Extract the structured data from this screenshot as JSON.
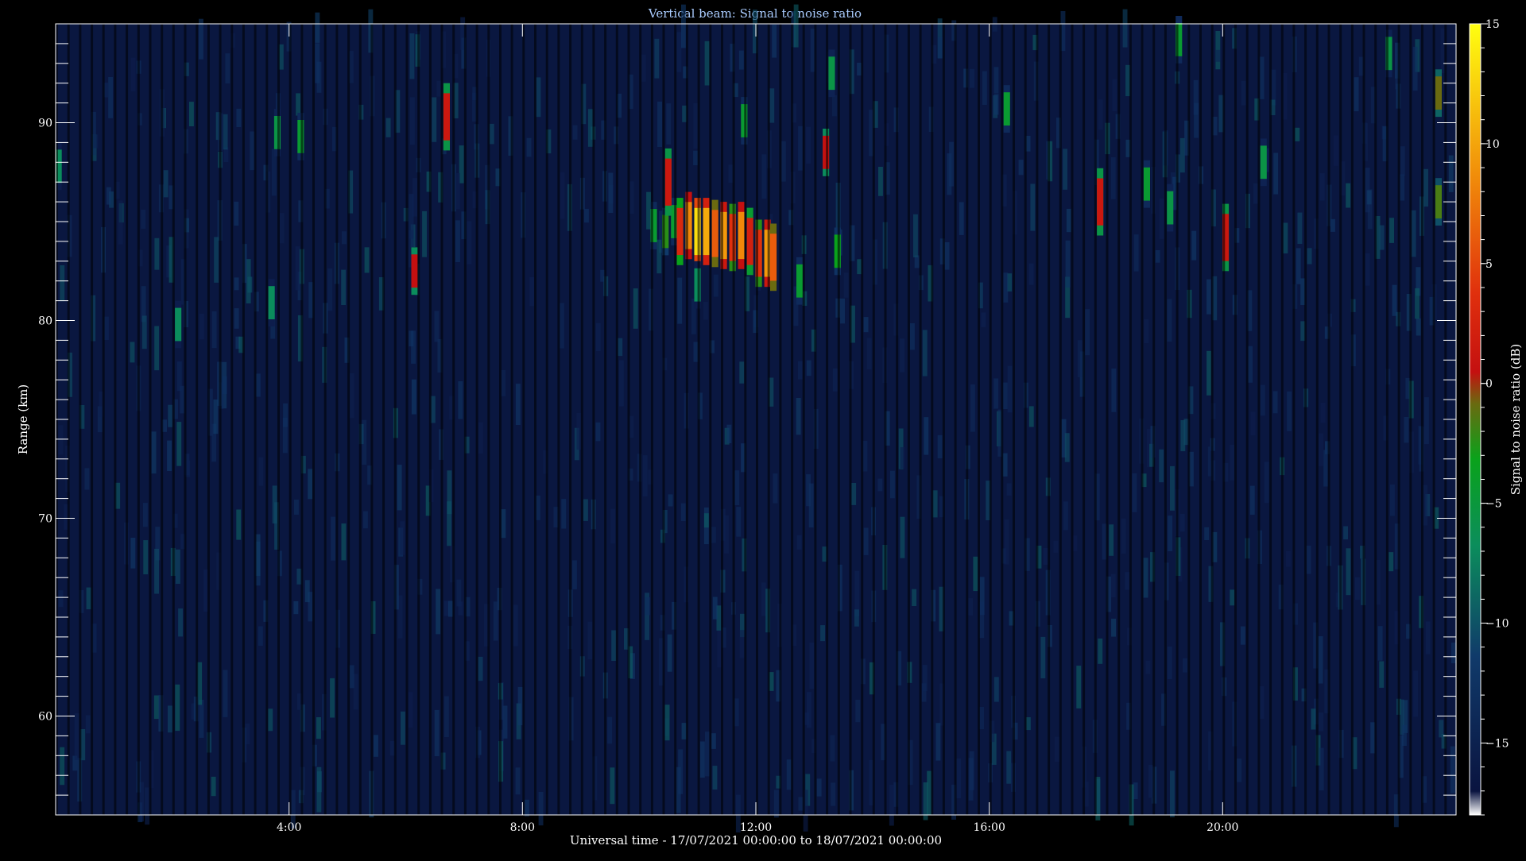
{
  "chart_data": {
    "type": "heatmap",
    "title": "Vertical beam: Signal to noise ratio",
    "xlabel": "Universal time - 17/07/2021 00:00:00 to 18/07/2021 00:00:00",
    "ylabel": "Range (km)",
    "colorbar_label": "Signal to noise ratio (dB)",
    "x_unit": "hours UT",
    "xlim": [
      0,
      24
    ],
    "ylim": [
      55,
      95
    ],
    "x_major_ticks": [
      4,
      8,
      12,
      16,
      20
    ],
    "x_tick_labels": [
      "4:00",
      "8:00",
      "12:00",
      "16:00",
      "20:00"
    ],
    "y_major_ticks": [
      60,
      70,
      80,
      90
    ],
    "y_tick_labels": [
      "60",
      "70",
      "80",
      "90"
    ],
    "y_minor_step": 1,
    "colorbar": {
      "min": -18,
      "max": 15,
      "ticks": [
        15,
        10,
        5,
        0,
        -5,
        -10,
        -15
      ],
      "tick_labels": [
        "15",
        "10",
        "5",
        "0",
        "−5",
        "−10",
        "−15"
      ]
    },
    "background_snr_db": -16,
    "strong_echoes": [
      {
        "time": 10.45,
        "range": 84.5,
        "snr": -4
      },
      {
        "time": 10.6,
        "range": 85.0,
        "snr": -6
      },
      {
        "time": 10.7,
        "range": 84.5,
        "snr": 3
      },
      {
        "time": 10.85,
        "range": 84.8,
        "snr": 8
      },
      {
        "time": 11.0,
        "range": 84.5,
        "snr": 13
      },
      {
        "time": 11.15,
        "range": 84.5,
        "snr": 10
      },
      {
        "time": 11.3,
        "range": 84.4,
        "snr": 6
      },
      {
        "time": 11.45,
        "range": 84.3,
        "snr": 9
      },
      {
        "time": 11.6,
        "range": 84.2,
        "snr": 4
      },
      {
        "time": 11.75,
        "range": 84.3,
        "snr": 8
      },
      {
        "time": 11.9,
        "range": 84.0,
        "snr": 2
      },
      {
        "time": 12.05,
        "range": 83.4,
        "snr": 4
      },
      {
        "time": 12.2,
        "range": 83.4,
        "snr": 9
      },
      {
        "time": 12.3,
        "range": 83.2,
        "snr": 6
      },
      {
        "time": 12.75,
        "range": 82.0,
        "snr": -6
      },
      {
        "time": 6.15,
        "range": 82.5,
        "snr": 0
      },
      {
        "time": 6.7,
        "range": 90.3,
        "snr": 1
      },
      {
        "time": 10.25,
        "range": 84.8,
        "snr": -6
      },
      {
        "time": 11.0,
        "range": 81.8,
        "snr": -8
      },
      {
        "time": 13.2,
        "range": 88.5,
        "snr": 0
      },
      {
        "time": 13.4,
        "range": 83.5,
        "snr": -5
      },
      {
        "time": 13.3,
        "range": 92.5,
        "snr": -7
      },
      {
        "time": 3.8,
        "range": 89.5,
        "snr": -7
      },
      {
        "time": 4.2,
        "range": 89.3,
        "snr": -6
      },
      {
        "time": 2.1,
        "range": 79.8,
        "snr": -8
      },
      {
        "time": 10.5,
        "range": 87.0,
        "snr": 1
      },
      {
        "time": 11.8,
        "range": 90.1,
        "snr": -6
      },
      {
        "time": 16.3,
        "range": 90.7,
        "snr": -6
      },
      {
        "time": 17.9,
        "range": 86.0,
        "snr": 1
      },
      {
        "time": 18.7,
        "range": 86.9,
        "snr": -6
      },
      {
        "time": 19.1,
        "range": 85.7,
        "snr": -7
      },
      {
        "time": 19.25,
        "range": 94.2,
        "snr": -6
      },
      {
        "time": 20.05,
        "range": 84.2,
        "snr": 1
      },
      {
        "time": 20.7,
        "range": 88.0,
        "snr": -7
      },
      {
        "time": 23.7,
        "range": 91.5,
        "snr": -2
      },
      {
        "time": 23.7,
        "range": 86.0,
        "snr": -3
      },
      {
        "time": 22.85,
        "range": 93.5,
        "snr": -7
      },
      {
        "time": 3.7,
        "range": 80.9,
        "snr": -8
      },
      {
        "time": 0.05,
        "range": 87.8,
        "snr": -8
      }
    ]
  },
  "colors": {
    "background": "#000000",
    "plot_background": "#0a1740",
    "axis": "#ffffff",
    "title": "#aaccff",
    "text": "#ffffff"
  }
}
